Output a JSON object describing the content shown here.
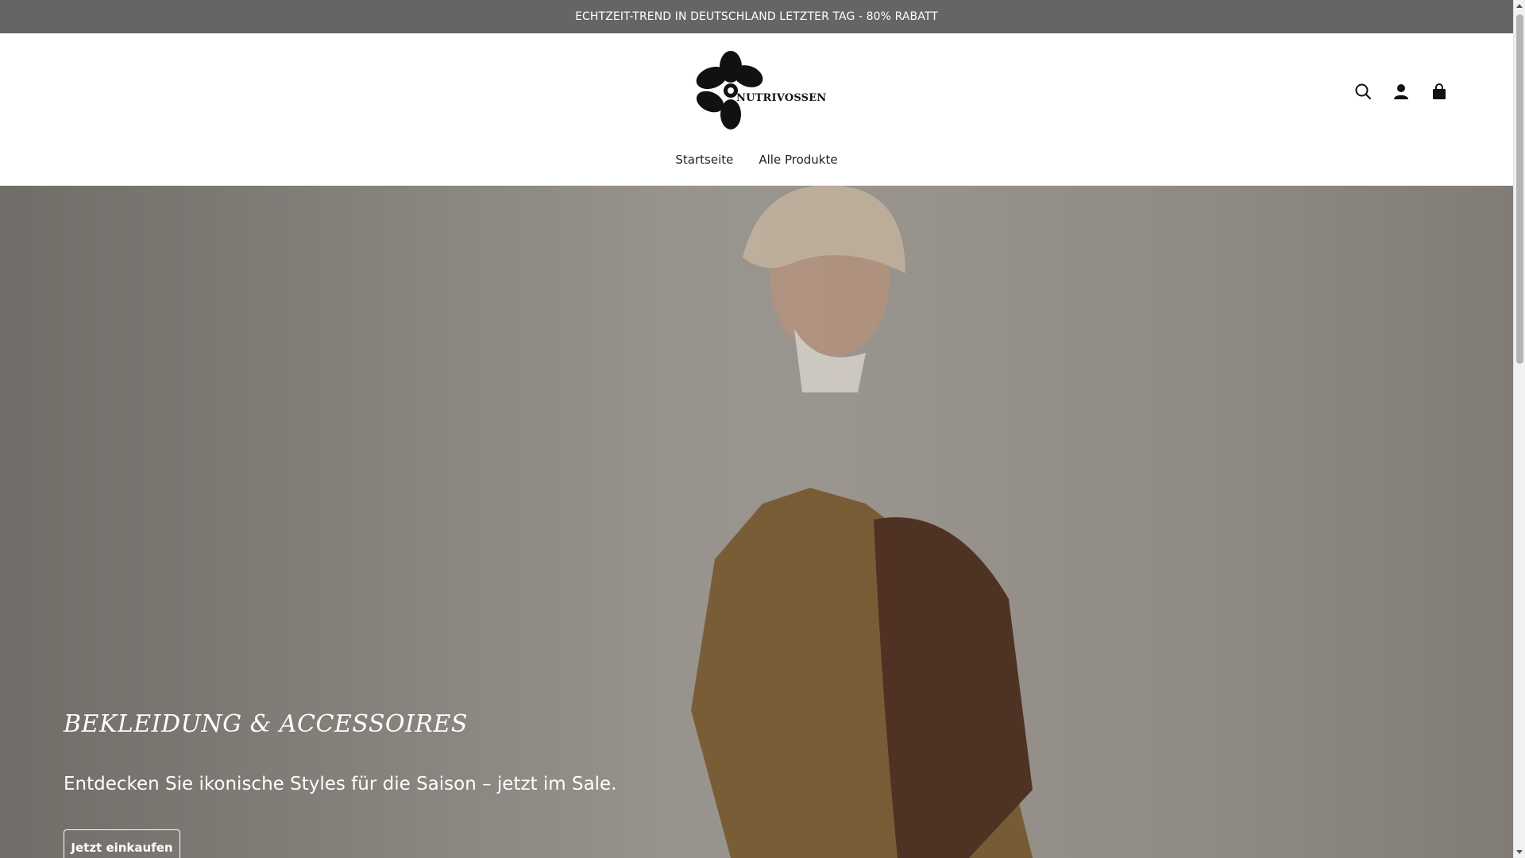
{
  "announcement": {
    "text": "ECHTZEIT-TREND IN DEUTSCHLAND LETZTER TAG - 80% RABATT"
  },
  "header": {
    "logo_text": "NUTRIVOSSEN",
    "icons": [
      "search-icon",
      "account-icon",
      "cart-icon"
    ],
    "nav": [
      {
        "label": "Startseite"
      },
      {
        "label": "Alle Produkte"
      }
    ]
  },
  "hero": {
    "title": "BEKLEIDUNG & ACCESSOIRES",
    "subtitle": "Entdecken Sie ikonische Styles für die Saison – jetzt im Sale.",
    "button_label": "Jetzt einkaufen"
  },
  "colors": {
    "announcement_bg": "#656565",
    "header_bg": "#ffffff",
    "hero_text": "#ffffff"
  }
}
